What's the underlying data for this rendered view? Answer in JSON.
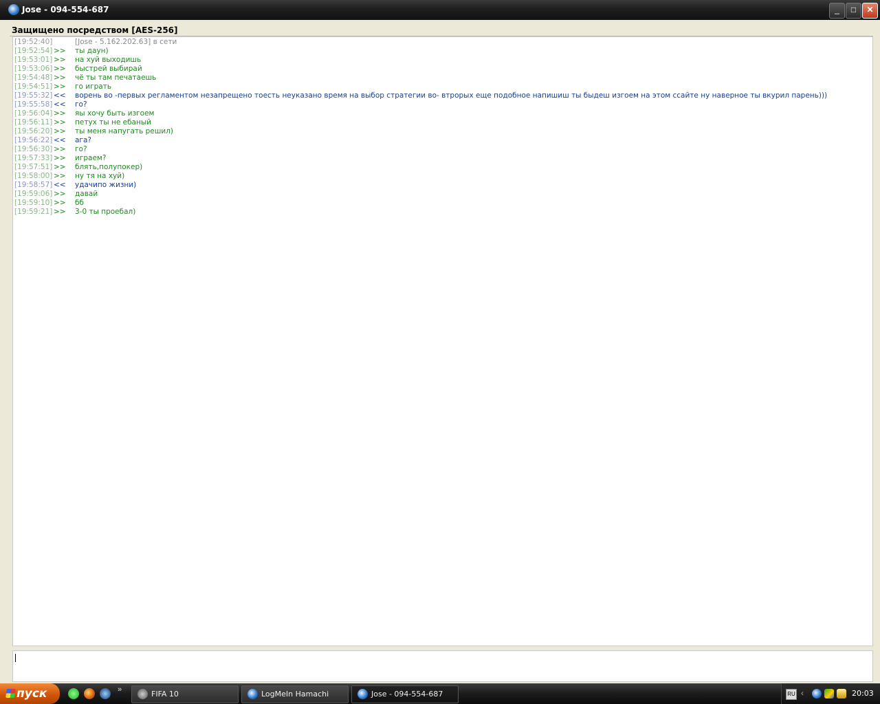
{
  "window": {
    "title": "Jose - 094-554-687"
  },
  "security": {
    "label": "Защищено посредством [AES-256]"
  },
  "messages": [
    {
      "time": "[19:52:40]",
      "dir": "",
      "text": "[Jose - 5.162.202.63] в сети",
      "kind": "sys"
    },
    {
      "time": "[19:52:54]",
      "dir": ">>",
      "text": "ты даун)",
      "kind": "in"
    },
    {
      "time": "[19:53:01]",
      "dir": ">>",
      "text": "на хуй выходишь",
      "kind": "in"
    },
    {
      "time": "[19:53:06]",
      "dir": ">>",
      "text": "быстрей выбирай",
      "kind": "in"
    },
    {
      "time": "[19:54:48]",
      "dir": ">>",
      "text": "чё ты там печатаешь",
      "kind": "in"
    },
    {
      "time": "[19:54:51]",
      "dir": ">>",
      "text": "го играть",
      "kind": "in"
    },
    {
      "time": "[19:55:32]",
      "dir": "<<",
      "text": "ворень во -первых регламентом незапрещено тоесть неуказано время на выбор стратегии  во- втрорых еще подобное напишиш ты быдеш изгоем на этом ссайте  ну наверное ты вкурил парень)))",
      "kind": "out"
    },
    {
      "time": "[19:55:58]",
      "dir": "<<",
      "text": "го?",
      "kind": "out"
    },
    {
      "time": "[19:56:04]",
      "dir": ">>",
      "text": "яы хочу быть изгоем",
      "kind": "in"
    },
    {
      "time": "[19:56:11]",
      "dir": ">>",
      "text": "петух ты не ебаный",
      "kind": "in"
    },
    {
      "time": "[19:56:20]",
      "dir": ">>",
      "text": "ты меня напугать решил)",
      "kind": "in"
    },
    {
      "time": "[19:56:22]",
      "dir": "<<",
      "text": "ага?",
      "kind": "out"
    },
    {
      "time": "[19:56:30]",
      "dir": ">>",
      "text": "го?",
      "kind": "in"
    },
    {
      "time": "[19:57:33]",
      "dir": ">>",
      "text": "играем?",
      "kind": "in"
    },
    {
      "time": "[19:57:51]",
      "dir": ">>",
      "text": "блять,полупокер)",
      "kind": "in"
    },
    {
      "time": "[19:58:00]",
      "dir": ">>",
      "text": "ну тя на хуй)",
      "kind": "in"
    },
    {
      "time": "[19:58:57]",
      "dir": "<<",
      "text": "удачипо жизни)",
      "kind": "out"
    },
    {
      "time": "[19:59:06]",
      "dir": ">>",
      "text": "давай",
      "kind": "in"
    },
    {
      "time": "[19:59:10]",
      "dir": ">>",
      "text": "бб",
      "kind": "in"
    },
    {
      "time": "[19:59:21]",
      "dir": ">>",
      "text": "3-0 ты проебал)",
      "kind": "in"
    }
  ],
  "taskbar": {
    "start_label": "пуск",
    "more": "»",
    "tasks": [
      {
        "label": "FIFA 10"
      },
      {
        "label": "LogMeIn Hamachi"
      },
      {
        "label": "Jose - 094-554-687"
      }
    ],
    "lang": "RU",
    "clock": "20:03"
  },
  "colors": {
    "incoming": "#1f8a1f",
    "outgoing": "#1a3e95",
    "system": "#8a8a8a"
  },
  "icons": {
    "app": "hamachi-icon",
    "min": "minimize-icon",
    "max": "maximize-icon",
    "close": "close-icon"
  }
}
